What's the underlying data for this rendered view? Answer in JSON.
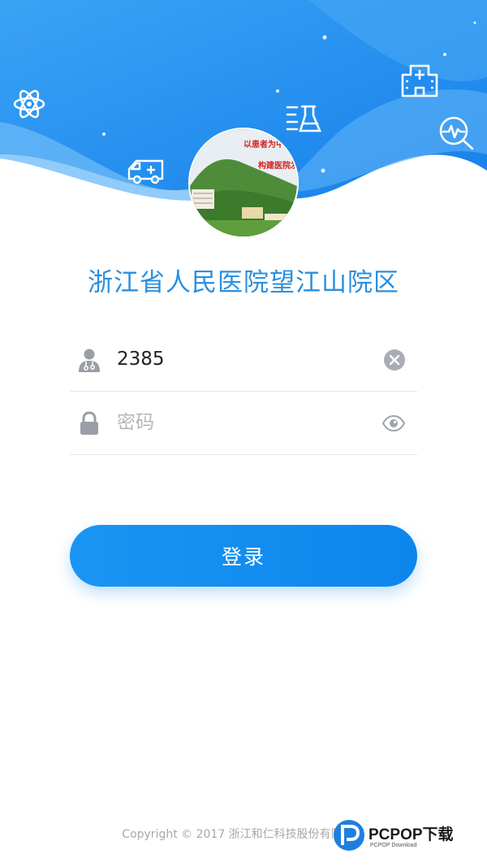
{
  "header": {
    "banner_text": [
      "以患者为中心",
      "构建医院发展"
    ],
    "colors": {
      "wave_dark": "#1f8ef0",
      "wave_light": "#67b6f7",
      "accent": "#2a8fe0"
    },
    "icons": [
      "atom-icon",
      "ambulance-icon",
      "flask-icon",
      "hospital-building-icon",
      "heart-monitor-icon"
    ]
  },
  "hospital_name": "浙江省人民医院望江山院区",
  "form": {
    "username": {
      "value": "2385",
      "icon": "doctor-user-icon",
      "clear_icon": "clear-icon"
    },
    "password": {
      "placeholder": "密码",
      "icon": "lock-icon",
      "toggle_icon": "eye-icon"
    },
    "login_label": "登录"
  },
  "footer": {
    "copyright": "Copyright © 2017 浙江和仁科技股份有限公司"
  },
  "watermark": {
    "title": "PCPOP下载",
    "subtitle": "PCPOP Download"
  }
}
